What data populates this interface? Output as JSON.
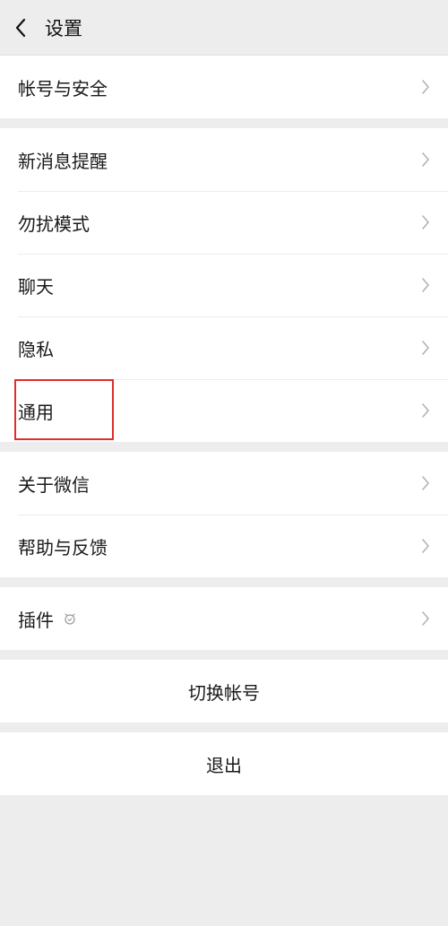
{
  "header": {
    "title": "设置",
    "back_icon": "chevron-left-icon"
  },
  "groups": [
    {
      "items": [
        {
          "label": "帐号与安全"
        }
      ]
    },
    {
      "items": [
        {
          "label": "新消息提醒"
        },
        {
          "label": "勿扰模式"
        },
        {
          "label": "聊天"
        },
        {
          "label": "隐私"
        },
        {
          "label": "通用",
          "highlighted": true
        }
      ]
    },
    {
      "items": [
        {
          "label": "关于微信"
        },
        {
          "label": "帮助与反馈"
        }
      ]
    },
    {
      "items": [
        {
          "label": "插件",
          "icon": "plugin-icon"
        }
      ]
    }
  ],
  "actions": {
    "switch_account": "切换帐号",
    "logout": "退出"
  },
  "colors": {
    "background": "#ededed",
    "row": "#ffffff",
    "highlight": "#e32b2b"
  }
}
